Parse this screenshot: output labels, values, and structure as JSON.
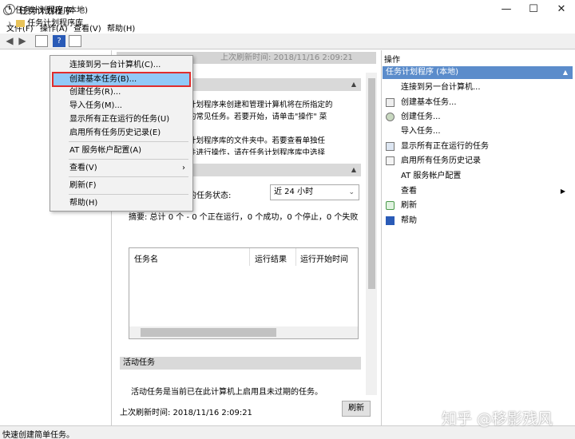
{
  "window": {
    "title": "任务计划程序",
    "minimize": "—",
    "maximize": "☐",
    "close": "✕"
  },
  "menubar": [
    "文件(F)",
    "操作(A)",
    "查看(V)",
    "帮助(H)"
  ],
  "tree": {
    "root": "任务计划程序 (本地)",
    "child": "任务计划程序库"
  },
  "center": {
    "header": "上次刷新时间: 2018/11/16 2:09:21",
    "overview_lines": [
      "计划程序来创建和管理计算机将在所指定的",
      "的常见任务。若要开始，请单击\"操作\" 菜",
      "",
      "计划程序库的文件夹中。若要查看单独任",
      "件进行操作，请在任务计划程序库中选择"
    ],
    "status_label": "的任务状态:",
    "status_select": "近 24 小时",
    "summary": "摘要: 总计 0 个 - 0 个正在运行，0 个成功，0 个停止，0 个失败",
    "grid_headers": [
      "任务名",
      "运行结果",
      "运行开始时间"
    ],
    "active_section": "活动任务",
    "active_text": "活动任务是当前已在此计算机上启用且未过期的任务。",
    "footer": "上次刷新时间: 2018/11/16 2:09:21",
    "refresh": "刷新"
  },
  "actions": {
    "title": "操作",
    "group": "任务计划程序 (本地)",
    "items": [
      {
        "label": "连接到另一台计算机...",
        "icon": "none"
      },
      {
        "label": "创建基本任务...",
        "icon": "task-wizard-icon"
      },
      {
        "label": "创建任务...",
        "icon": "create-task-icon"
      },
      {
        "label": "导入任务...",
        "icon": "none"
      },
      {
        "label": "显示所有正在运行的任务",
        "icon": "running-tasks-icon"
      },
      {
        "label": "启用所有任务历史记录",
        "icon": "history-icon"
      },
      {
        "label": "AT 服务帐户配置",
        "icon": "none"
      },
      {
        "label": "查看",
        "icon": "none",
        "submenu": "▶"
      },
      {
        "label": "刷新",
        "icon": "refresh-icon"
      },
      {
        "label": "帮助",
        "icon": "help-icon"
      }
    ]
  },
  "context_menu": [
    "连接到另一台计算机(C)...",
    "创建基本任务(B)...",
    "创建任务(R)...",
    "导入任务(M)...",
    "显示所有正在运行的任务(U)",
    "启用所有任务历史记录(E)",
    "AT 服务帐户配置(A)",
    "查看(V)",
    "刷新(F)",
    "帮助(H)"
  ],
  "context_submenu_arrow": "›",
  "statusbar": "快速创建简单任务。",
  "watermark": "知乎 @移影残风",
  "colors": {
    "selection": "#5b8ccb",
    "highlight": "#91c9f7",
    "outline": "#e02d2d"
  }
}
